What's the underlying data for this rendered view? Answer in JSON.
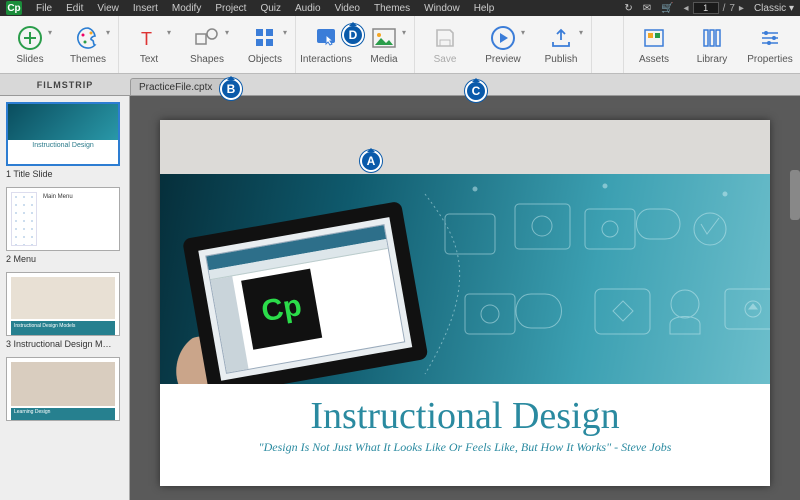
{
  "app": {
    "logo": "Cp"
  },
  "menu": [
    "File",
    "Edit",
    "View",
    "Insert",
    "Modify",
    "Project",
    "Quiz",
    "Audio",
    "Video",
    "Themes",
    "Window",
    "Help"
  ],
  "pager": {
    "current": "1",
    "total": "7"
  },
  "workspace_mode": "Classic",
  "toolbar": {
    "slides": "Slides",
    "themes": "Themes",
    "text": "Text",
    "shapes": "Shapes",
    "objects": "Objects",
    "interactions": "Interactions",
    "media": "Media",
    "save": "Save",
    "preview": "Preview",
    "publish": "Publish",
    "assets": "Assets",
    "library": "Library",
    "properties": "Properties"
  },
  "filmstrip": {
    "header": "FILMSTRIP",
    "items": [
      {
        "caption": "1 Title Slide",
        "mini": "Instructional Design"
      },
      {
        "caption": "2 Menu",
        "mini": "Main Menu"
      },
      {
        "caption": "3 Instructional Design M…",
        "mini": "Instructional Design Models"
      },
      {
        "caption": "",
        "mini": "Learning Design"
      }
    ]
  },
  "file_tab": {
    "name": "PracticeFile.cptx"
  },
  "slide": {
    "title": "Instructional Design",
    "quote": "\"Design Is Not Just What It Looks Like Or Feels Like, But How It Works\" - Steve Jobs",
    "logo": "Cp"
  },
  "callouts": {
    "a": "A",
    "b": "B",
    "c": "C",
    "d": "D"
  }
}
